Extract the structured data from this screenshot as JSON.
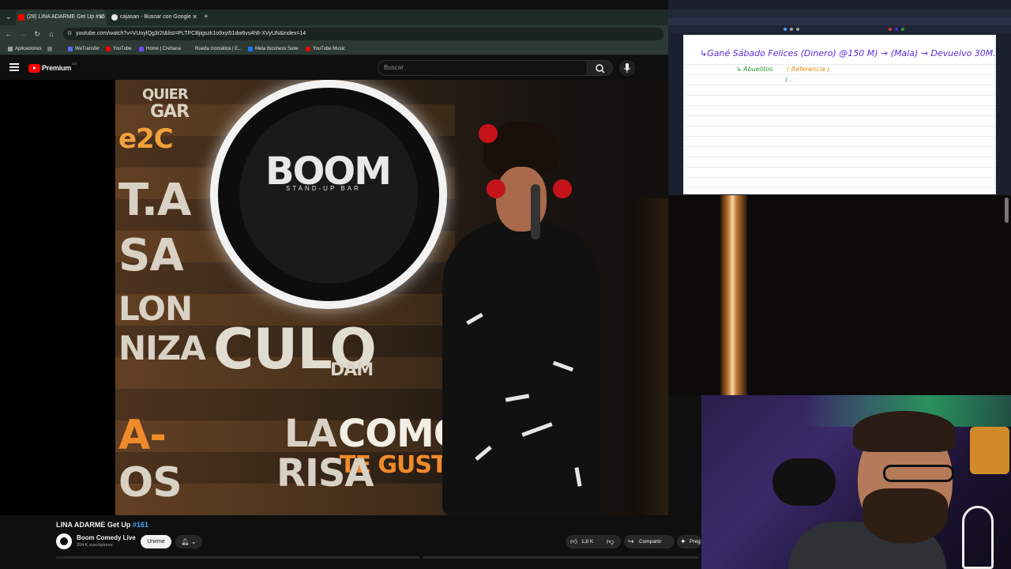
{
  "browser": {
    "tabs": [
      {
        "label": "(28) LINA ADARME Get Up #16",
        "active": true,
        "favicon": "youtube-favicon"
      },
      {
        "label": "cajasan - Buscar con Google",
        "active": false,
        "favicon": "google-favicon"
      }
    ],
    "url": "youtube.com/watch?v=VUnylQg3r2I&list=PLTPCBjigszk1o9xyi51dw6vs4h8-XVyUN&index=14",
    "bookmarks": [
      {
        "label": "Aplicaciones",
        "color": "#9aa0a6"
      },
      {
        "label": "WeTransfer",
        "color": "#5a6bf0"
      },
      {
        "label": "YouTube",
        "color": "#ff0000"
      },
      {
        "label": "Home | Crehana",
        "color": "#6a4cff"
      },
      {
        "label": "Rueda cromática | E...",
        "color": "#333333"
      },
      {
        "label": "Meta Business Suite",
        "color": "#1877f2"
      },
      {
        "label": "YouTube Music",
        "color": "#ff0000"
      }
    ]
  },
  "youtube": {
    "logo_text": "Premium",
    "logo_country": "CO",
    "search_placeholder": "Buscar",
    "wall_words": [
      "QUIER",
      "GAR",
      "e2C",
      "T.A",
      "SA",
      "LON",
      "NIZA",
      "CULO",
      "A-",
      "OS",
      "COMO",
      "TE GUSTA",
      "LA",
      "RISA",
      "DAM"
    ],
    "sign_text": "BOOM",
    "sign_sub": "STAND-UP BAR",
    "video_title": "LINA ADARME Get Up ",
    "video_tag": "#161",
    "channel_name": "Boom Comedy Live",
    "channel_subs": "204 K suscriptores",
    "join_label": "Unirme",
    "like_count": "1,8 K",
    "share_label": "Compartir",
    "more_label": "Preg"
  },
  "notes": {
    "line1": "↳Gané Sábado Felices (Dinero) @150 M) → (Mala) → Devuelvo 30M.",
    "line2": "↳ Abuelitos",
    "line2b": "( Referencia )",
    "line3": "( ."
  },
  "colors": {
    "accent_blue": "#3ea6ff",
    "youtube_red": "#ff0000",
    "ink_purple": "#5a2bd8",
    "ink_green": "#2e9b2e",
    "ink_orange": "#e08a12"
  }
}
